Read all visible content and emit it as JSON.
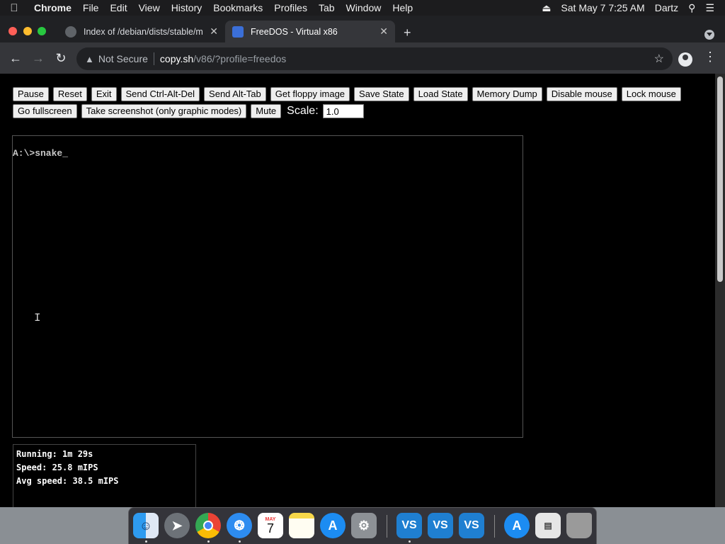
{
  "menubar": {
    "app_name": "Chrome",
    "items": [
      "File",
      "Edit",
      "View",
      "History",
      "Bookmarks",
      "Profiles",
      "Tab",
      "Window",
      "Help"
    ],
    "datetime": "Sat May 7  7:25 AM",
    "user": "Dartz"
  },
  "tabs": [
    {
      "title": "Index of /debian/dists/stable/m",
      "active": false
    },
    {
      "title": "FreeDOS - Virtual x86",
      "active": true
    }
  ],
  "omnibox": {
    "security": "Not Secure",
    "host": "copy.sh",
    "path": "/v86/?profile=freedos"
  },
  "controls": {
    "row1": [
      "Pause",
      "Reset",
      "Exit",
      "Send Ctrl-Alt-Del",
      "Send Alt-Tab",
      "Get floppy image",
      "Save State",
      "Load State",
      "Memory Dump",
      "Disable mouse",
      "Lock mouse"
    ],
    "row2": [
      "Go fullscreen",
      "Take screenshot (only graphic modes)",
      "Mute"
    ],
    "scale_label": "Scale:",
    "scale_value": "1.0"
  },
  "screen": {
    "prompt_line": "A:\\>snake_"
  },
  "stats": {
    "running": "Running: 1m 29s",
    "speed": "Speed: 25.8 mIPS",
    "avg_speed": "Avg speed: 38.5 mIPS"
  },
  "dock": {
    "calendar_month": "MAY",
    "calendar_day": "7"
  },
  "colors": {
    "menubar_bg": "#1c1c1e",
    "tabstrip_bg": "#202124",
    "toolbar_bg": "#35363a",
    "close_red": "#ff5f57",
    "minimize_yellow": "#febc2e",
    "zoom_green": "#28c840"
  }
}
